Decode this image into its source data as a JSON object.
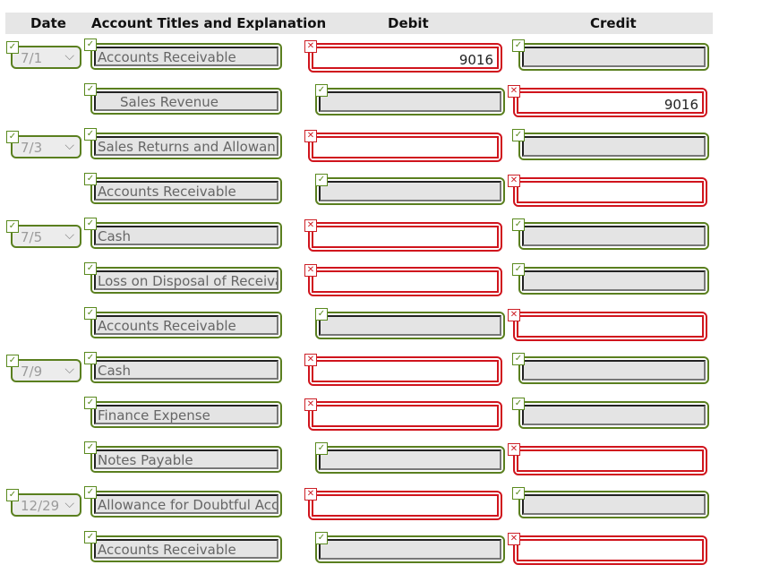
{
  "header": {
    "date": "Date",
    "account": "Account Titles and Explanation",
    "debit": "Debit",
    "credit": "Credit"
  },
  "icons": {
    "correct": "✓",
    "incorrect": "✕",
    "chevron": "⌄"
  },
  "status_colors": {
    "correct": "#5a7f1f",
    "incorrect": "#d0141d"
  },
  "rows": [
    {
      "date": "7/1",
      "account": "Accounts Receivable",
      "indent": false,
      "debit": "9016",
      "debit_status": "incorrect",
      "credit": "",
      "credit_status": "correct",
      "date_status": "correct",
      "account_status": "correct"
    },
    {
      "date": null,
      "account": "Sales Revenue",
      "indent": true,
      "debit": "",
      "debit_status": "correct",
      "credit": "9016",
      "credit_status": "incorrect",
      "account_status": "correct"
    },
    {
      "date": "7/3",
      "account": "Sales Returns and Allowan",
      "indent": false,
      "debit": "",
      "debit_status": "incorrect",
      "credit": "",
      "credit_status": "correct",
      "date_status": "correct",
      "account_status": "correct"
    },
    {
      "date": null,
      "account": "Accounts Receivable",
      "indent": false,
      "debit": "",
      "debit_status": "correct",
      "credit": "",
      "credit_status": "incorrect",
      "account_status": "correct"
    },
    {
      "date": "7/5",
      "account": "Cash",
      "indent": false,
      "debit": "",
      "debit_status": "incorrect",
      "credit": "",
      "credit_status": "correct",
      "date_status": "correct",
      "account_status": "correct"
    },
    {
      "date": null,
      "account": "Loss on Disposal of Receiva",
      "indent": false,
      "debit": "",
      "debit_status": "incorrect",
      "credit": "",
      "credit_status": "correct",
      "account_status": "correct"
    },
    {
      "date": null,
      "account": "Accounts Receivable",
      "indent": false,
      "debit": "",
      "debit_status": "correct",
      "credit": "",
      "credit_status": "incorrect",
      "account_status": "correct"
    },
    {
      "date": "7/9",
      "account": "Cash",
      "indent": false,
      "debit": "",
      "debit_status": "incorrect",
      "credit": "",
      "credit_status": "correct",
      "date_status": "correct",
      "account_status": "correct"
    },
    {
      "date": null,
      "account": "Finance Expense",
      "indent": false,
      "debit": "",
      "debit_status": "incorrect",
      "credit": "",
      "credit_status": "correct",
      "account_status": "correct"
    },
    {
      "date": null,
      "account": "Notes Payable",
      "indent": false,
      "debit": "",
      "debit_status": "correct",
      "credit": "",
      "credit_status": "incorrect",
      "account_status": "correct"
    },
    {
      "date": "12/29",
      "account": "Allowance for Doubtful Acc",
      "indent": false,
      "debit": "",
      "debit_status": "incorrect",
      "credit": "",
      "credit_status": "correct",
      "date_status": "correct",
      "account_status": "correct"
    },
    {
      "date": null,
      "account": "Accounts Receivable",
      "indent": false,
      "debit": "",
      "debit_status": "correct",
      "credit": "",
      "credit_status": "incorrect",
      "account_status": "correct"
    }
  ]
}
